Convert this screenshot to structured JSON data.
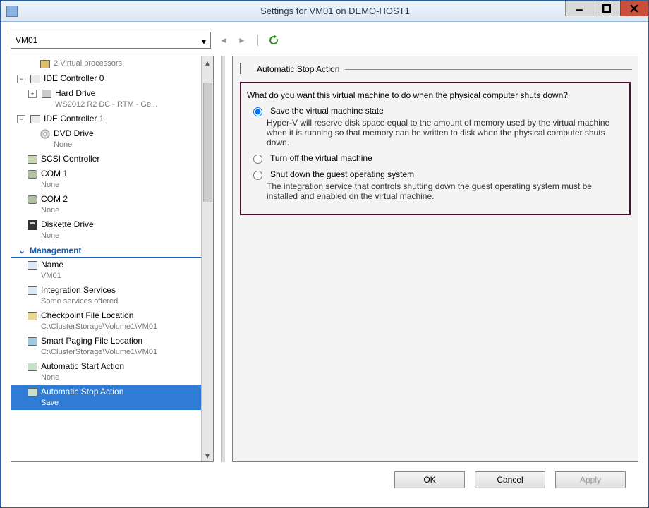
{
  "window": {
    "title": "Settings for VM01 on DEMO-HOST1"
  },
  "vm_selector": {
    "value": "VM01"
  },
  "sidebar": {
    "top_trunc": "2 Virtual processors",
    "ide0": {
      "label": "IDE Controller 0",
      "hd": {
        "label": "Hard Drive",
        "sub": "WS2012 R2 DC - RTM - Ge..."
      }
    },
    "ide1": {
      "label": "IDE Controller 1",
      "dvd": {
        "label": "DVD Drive",
        "sub": "None"
      }
    },
    "scsi": {
      "label": "SCSI Controller"
    },
    "com1": {
      "label": "COM 1",
      "sub": "None"
    },
    "com2": {
      "label": "COM 2",
      "sub": "None"
    },
    "floppy": {
      "label": "Diskette Drive",
      "sub": "None"
    },
    "mgmt_head": "Management",
    "name": {
      "label": "Name",
      "sub": "VM01"
    },
    "integ": {
      "label": "Integration Services",
      "sub": "Some services offered"
    },
    "chk": {
      "label": "Checkpoint File Location",
      "sub": "C:\\ClusterStorage\\Volume1\\VM01"
    },
    "spf": {
      "label": "Smart Paging File Location",
      "sub": "C:\\ClusterStorage\\Volume1\\VM01"
    },
    "astart": {
      "label": "Automatic Start Action",
      "sub": "None"
    },
    "astop": {
      "label": "Automatic Stop Action",
      "sub": "Save"
    }
  },
  "panel": {
    "title": "Automatic Stop Action",
    "question": "What do you want this virtual machine to do when the physical computer shuts down?",
    "opt1": {
      "label": "Save the virtual machine state",
      "desc": "Hyper-V will reserve disk space equal to the amount of memory used by the virtual machine when it is running so that memory can be written to disk when the physical computer shuts down."
    },
    "opt2": {
      "label": "Turn off the virtual machine"
    },
    "opt3": {
      "label": "Shut down the guest operating system",
      "desc": "The integration service that controls shutting down the guest operating system must be installed and enabled on the virtual machine."
    }
  },
  "buttons": {
    "ok": "OK",
    "cancel": "Cancel",
    "apply": "Apply"
  }
}
